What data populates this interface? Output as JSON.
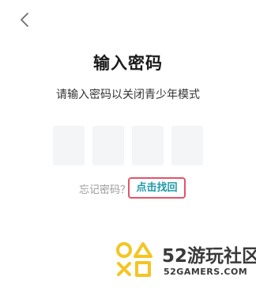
{
  "header": {
    "back_icon": "chevron-left-icon"
  },
  "page": {
    "title": "输入密码",
    "subtitle": "请输入密码以关闭青少年模式"
  },
  "password": {
    "boxes": [
      "",
      "",
      "",
      ""
    ]
  },
  "forgot": {
    "prompt": "忘记密码？",
    "link_label": "点击找回",
    "link_color": "#1e9aa8",
    "highlight_color": "#e2546a"
  },
  "watermark": {
    "name": "52游玩社区",
    "domain": "52GAMERS.COM",
    "logo_color": "#f3c623"
  }
}
